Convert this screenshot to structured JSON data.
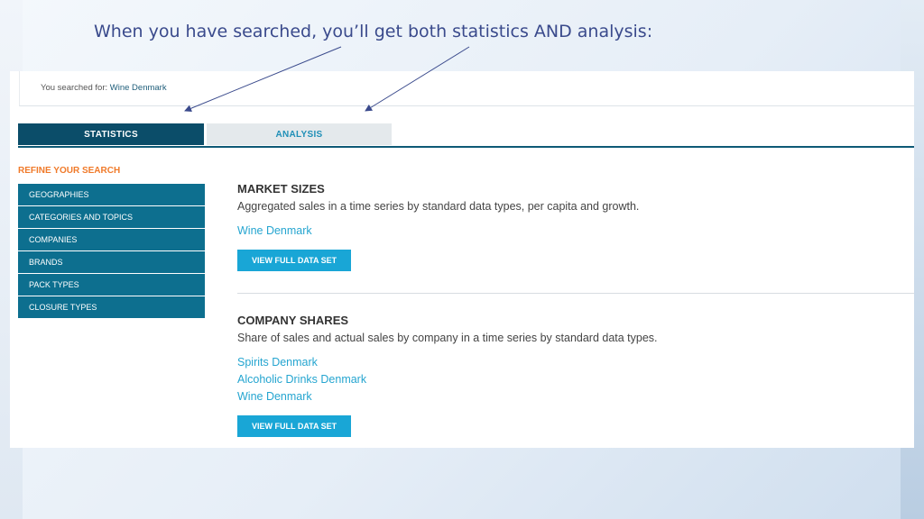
{
  "caption": "When you have searched, you’ll get both statistics AND analysis:",
  "search": {
    "label": "You searched for:",
    "term": "Wine Denmark"
  },
  "tabs": [
    {
      "label": "STATISTICS",
      "active": true
    },
    {
      "label": "ANALYSIS",
      "active": false
    }
  ],
  "refine_title": "REFINE YOUR SEARCH",
  "sidebar": {
    "items": [
      {
        "label": "GEOGRAPHIES"
      },
      {
        "label": "CATEGORIES AND TOPICS"
      },
      {
        "label": "COMPANIES"
      },
      {
        "label": "BRANDS"
      },
      {
        "label": "PACK TYPES"
      },
      {
        "label": "CLOSURE TYPES"
      }
    ]
  },
  "sections": [
    {
      "title": "MARKET SIZES",
      "description": "Aggregated sales in a time series by standard data types, per capita and growth.",
      "links": [
        "Wine Denmark"
      ],
      "button": "VIEW FULL DATA SET"
    },
    {
      "title": "COMPANY SHARES",
      "description": "Share of sales and actual sales by company in a time series by standard data types.",
      "links": [
        "Spirits Denmark",
        "Alcoholic Drinks Denmark",
        "Wine Denmark"
      ],
      "button": "VIEW FULL DATA SET"
    }
  ],
  "colors": {
    "tab_active": "#0b4d69",
    "sidebar": "#0d6f8f",
    "accent": "#19a6d6",
    "refine": "#f07a2a",
    "caption": "#3a4a8c"
  }
}
